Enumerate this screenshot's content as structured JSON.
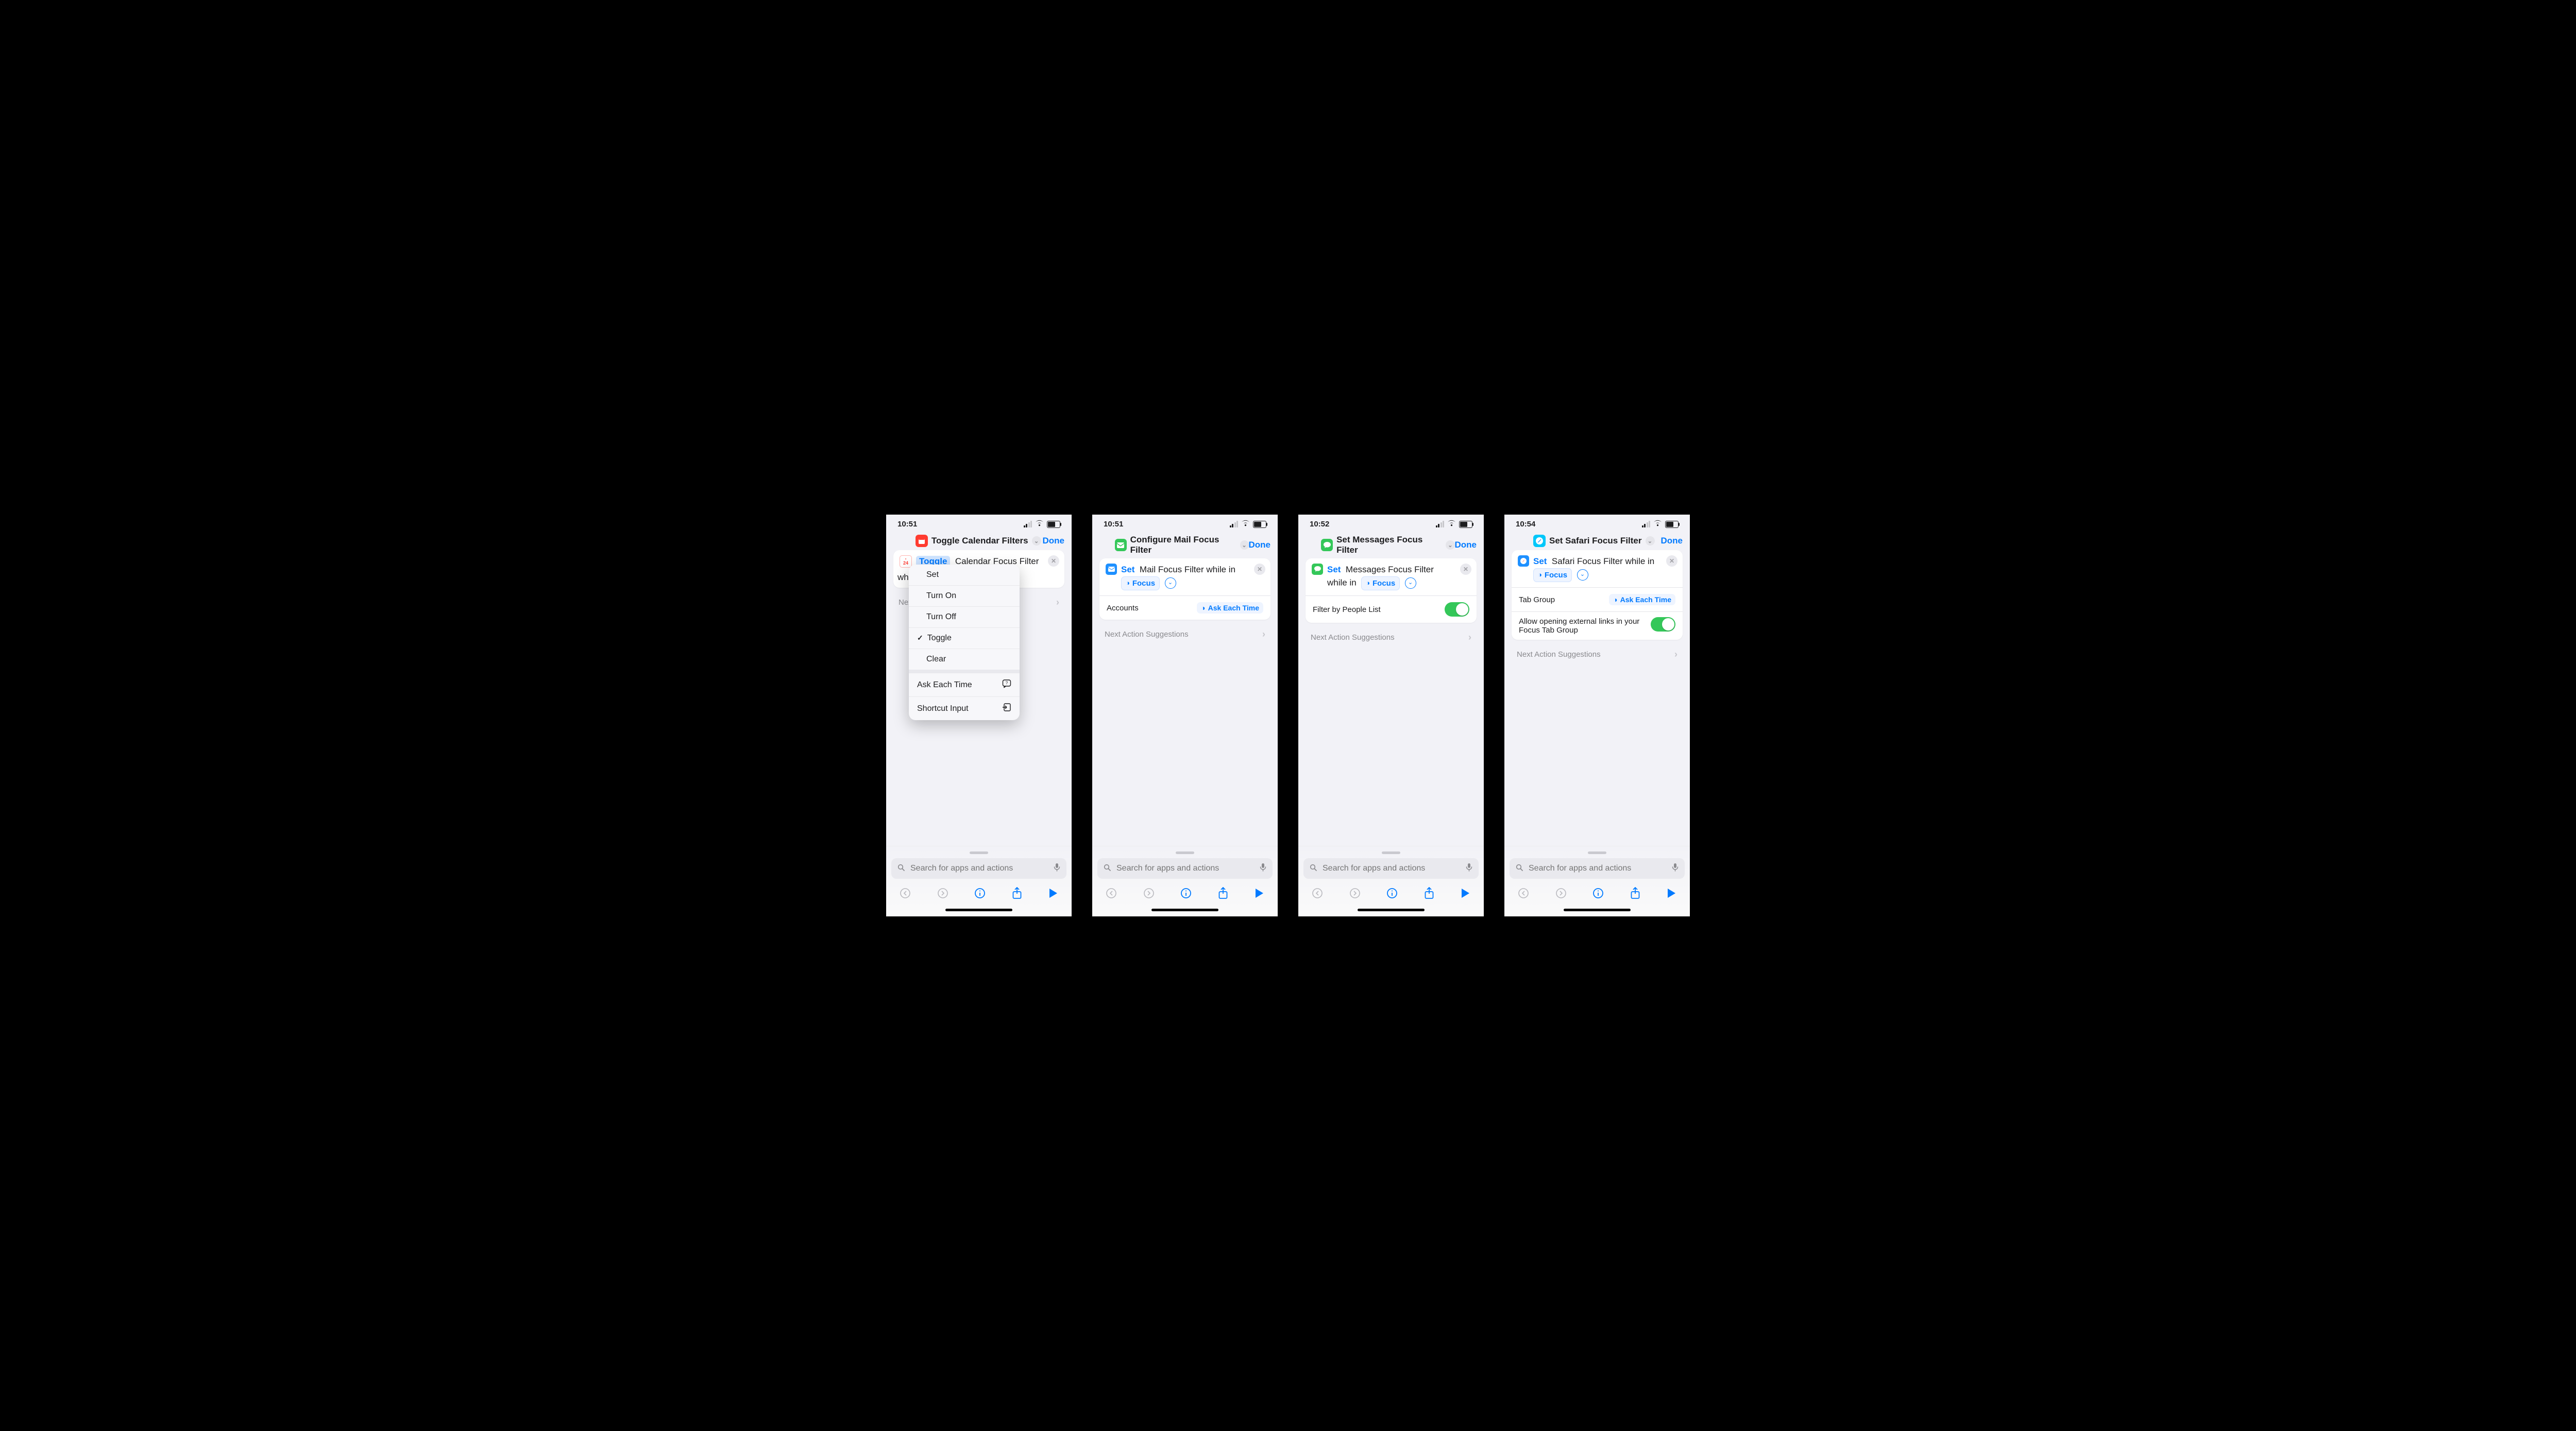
{
  "phones": [
    {
      "time": "10:51",
      "title": "Toggle Calendar Filters",
      "done": "Done",
      "card": {
        "verb_highlighted": "Toggle",
        "rest": "Calendar Focus Filter",
        "trail": "whi"
      },
      "next": "Next Action Suggestions",
      "menu": {
        "items": [
          "Set",
          "Turn On",
          "Turn Off",
          "Toggle",
          "Clear"
        ],
        "checked_index": 3,
        "extra": [
          "Ask Each Time",
          "Shortcut Input"
        ]
      }
    },
    {
      "time": "10:51",
      "title": "Configure Mail Focus Filter",
      "done": "Done",
      "card": {
        "verb": "Set",
        "rest": "Mail Focus Filter while in",
        "focus_label": "Focus"
      },
      "row": {
        "label": "Accounts",
        "ask": "Ask Each Time"
      },
      "next": "Next Action Suggestions"
    },
    {
      "time": "10:52",
      "title": "Set Messages Focus Filter",
      "done": "Done",
      "card": {
        "verb": "Set",
        "rest1": "Messages Focus Filter",
        "rest2": "while in",
        "focus_label": "Focus"
      },
      "row": {
        "label": "Filter by People List"
      },
      "next": "Next Action Suggestions"
    },
    {
      "time": "10:54",
      "title": "Set Safari Focus Filter",
      "done": "Done",
      "card": {
        "verb": "Set",
        "rest": "Safari Focus Filter while in",
        "focus_label": "Focus"
      },
      "rows": [
        {
          "label": "Tab Group",
          "ask": "Ask Each Time"
        },
        {
          "label": "Allow opening external links in your Focus Tab Group"
        }
      ],
      "next": "Next Action Suggestions"
    }
  ],
  "search_placeholder": "Search for apps and actions"
}
